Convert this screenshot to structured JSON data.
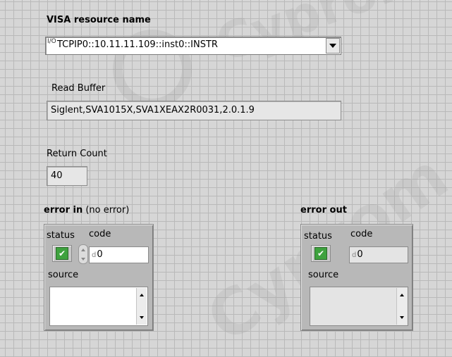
{
  "visa": {
    "label": "VISA resource name",
    "io_prefix": "I/O",
    "value": "TCPIP0::10.11.11.109::inst0::INSTR"
  },
  "read_buffer": {
    "label": "Read Buffer",
    "value": "Siglent,SVA1015X,SVA1XEAX2R0031,2.0.1.9"
  },
  "return_count": {
    "label": "Return Count",
    "value": "40"
  },
  "error_in": {
    "title": "error in",
    "subtitle": "(no error)",
    "status_label": "status",
    "status_mark": "✔",
    "code_label": "code",
    "code_prefix": "d",
    "code_value": "0",
    "source_label": "source",
    "source_value": ""
  },
  "error_out": {
    "title": "error out",
    "status_label": "status",
    "status_mark": "✔",
    "code_label": "code",
    "code_prefix": "d",
    "code_value": "0",
    "source_label": "source",
    "source_value": ""
  },
  "watermark": "Cyprom",
  "colors": {
    "panel_background": "#d6d6d6",
    "grid_line": "#b9b9b9",
    "status_green": "#3ea23e",
    "cluster_frame": "#b8b8b8"
  }
}
